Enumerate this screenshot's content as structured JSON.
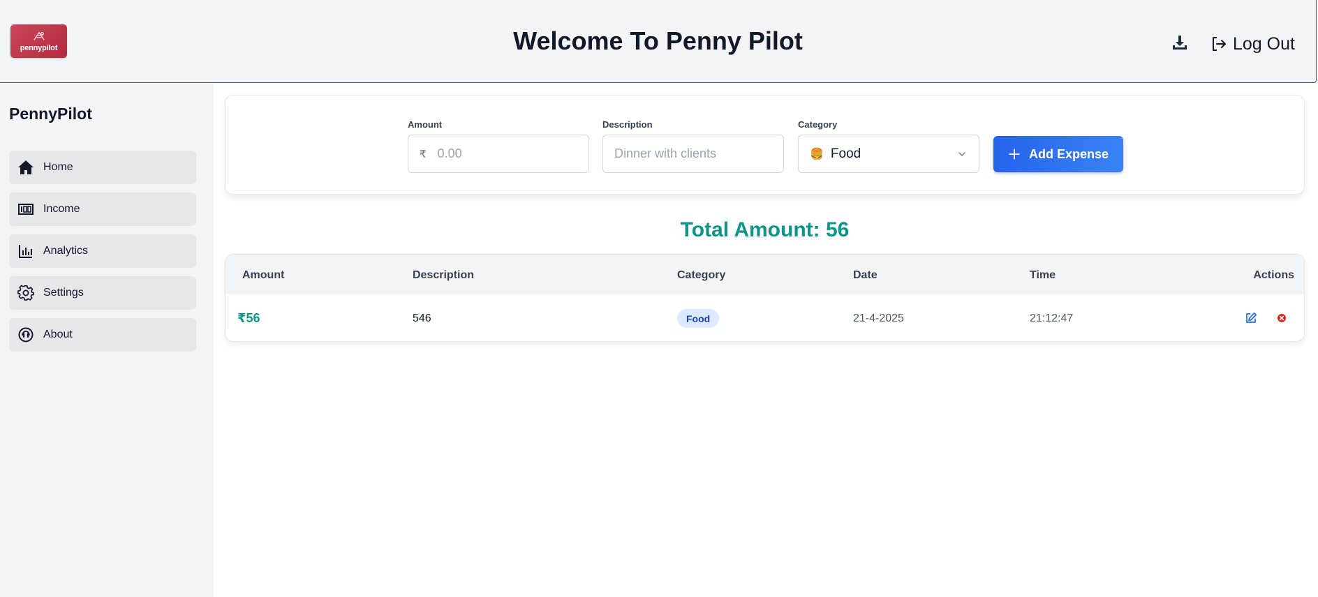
{
  "header": {
    "logo_text": "pennypilot",
    "title": "Welcome To Penny Pilot",
    "logout_label": "Log Out"
  },
  "sidebar": {
    "brand": "PennyPilot",
    "items": [
      {
        "label": "Home",
        "icon": "home-icon"
      },
      {
        "label": "Income",
        "icon": "income-icon"
      },
      {
        "label": "Analytics",
        "icon": "analytics-icon"
      },
      {
        "label": "Settings",
        "icon": "gear-icon"
      },
      {
        "label": "About",
        "icon": "about-icon"
      }
    ]
  },
  "form": {
    "amount": {
      "label": "Amount",
      "currency": "₹",
      "placeholder": "0.00",
      "value": ""
    },
    "description": {
      "label": "Description",
      "placeholder": "Dinner with clients",
      "value": ""
    },
    "category": {
      "label": "Category",
      "emoji": "🍔",
      "selected": "Food"
    },
    "add_button": "Add Expense"
  },
  "total": {
    "text": "Total Amount: 56"
  },
  "table": {
    "headers": [
      "Amount",
      "Description",
      "Category",
      "Date",
      "Time",
      "Actions"
    ],
    "rows": [
      {
        "amount": "₹56",
        "description": "546",
        "category": "Food",
        "date": "21-4-2025",
        "time": "21:12:47"
      }
    ]
  },
  "colors": {
    "accent_teal": "#0d9488",
    "primary_blue": "#2563eb",
    "logo_red": "#c8475a",
    "delete_red": "#dc2626"
  }
}
